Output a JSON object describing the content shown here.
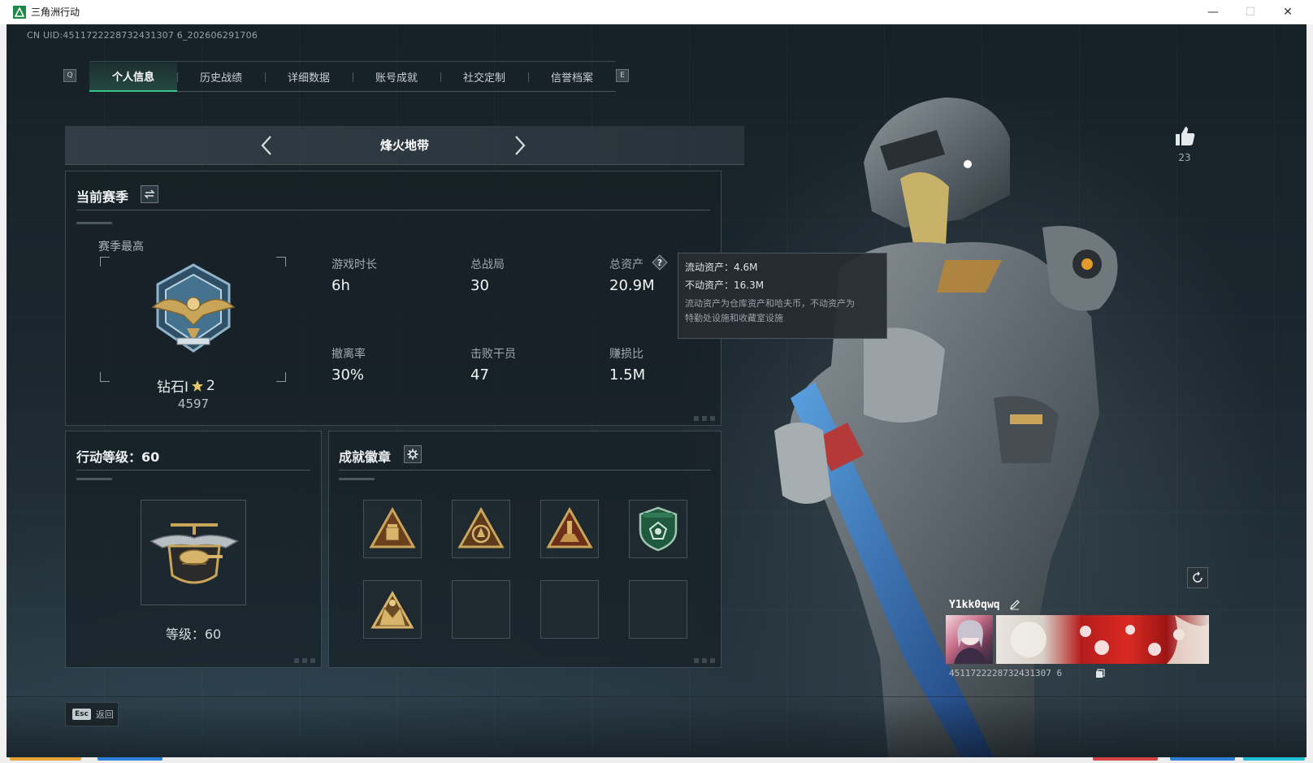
{
  "window": {
    "title": "三角洲行动",
    "minimize_glyph": "—",
    "maximize_glyph": "☐",
    "close_glyph": "✕"
  },
  "header": {
    "uid_text": "CN UID:4511722228732431307 6_202606291706"
  },
  "tabs": {
    "left_key": "Q",
    "right_key": "E",
    "items": [
      {
        "label": "个人信息",
        "active": true
      },
      {
        "label": "历史战绩",
        "active": false
      },
      {
        "label": "详细数据",
        "active": false
      },
      {
        "label": "账号成就",
        "active": false
      },
      {
        "label": "社交定制",
        "active": false
      },
      {
        "label": "信誉档案",
        "active": false
      }
    ]
  },
  "mode": {
    "title": "烽火地带"
  },
  "season": {
    "title": "当前赛季",
    "best_label": "赛季最高",
    "rank_name": "钻石I",
    "rank_stars": "2",
    "rank_score": "4597",
    "stats": [
      {
        "label": "游戏时长",
        "value": "6h"
      },
      {
        "label": "总战局",
        "value": "30"
      },
      {
        "label": "总资产",
        "value": "20.9M"
      },
      {
        "label": "撤离率",
        "value": "30%"
      },
      {
        "label": "击败干员",
        "value": "47"
      },
      {
        "label": "赚损比",
        "value": "1.5M"
      }
    ]
  },
  "tooltip": {
    "liquid": "流动资产：4.6M",
    "fixed": "不动资产：16.3M",
    "note_line1": "流动资产为仓库资产和哈夫币，不动资产为",
    "note_line2": "特勤处设施和收藏室设施"
  },
  "level": {
    "title": "行动等级：60",
    "level_text": "等级：60"
  },
  "badges": {
    "title": "成就徽章",
    "slots": [
      {
        "icon": "triangle-crate-badge-icon",
        "filled": true
      },
      {
        "icon": "triangle-emblem-badge-icon",
        "filled": true
      },
      {
        "icon": "triangle-tower-badge-icon",
        "filled": true
      },
      {
        "icon": "shield-badge-icon",
        "filled": true
      },
      {
        "icon": "crown-triangle-badge-icon",
        "filled": true
      },
      {
        "icon": "empty-slot",
        "filled": false
      },
      {
        "icon": "empty-slot",
        "filled": false
      },
      {
        "icon": "empty-slot",
        "filled": false
      }
    ]
  },
  "profile": {
    "like_count": "23",
    "player_name": "Y1kk0qwq",
    "uid_text": "4511722228732431307 6"
  },
  "footer": {
    "esc_key": "Esc",
    "back_label": "返回"
  },
  "colors": {
    "accent_green": "#36c48a",
    "gold": "#c9a55a",
    "panel_bg": "#16202680",
    "taskbar_orange": "#e8a23a",
    "taskbar_blue": "#2f7fd8",
    "taskbar_red": "#d84444",
    "taskbar_cyan": "#21c1d6"
  }
}
